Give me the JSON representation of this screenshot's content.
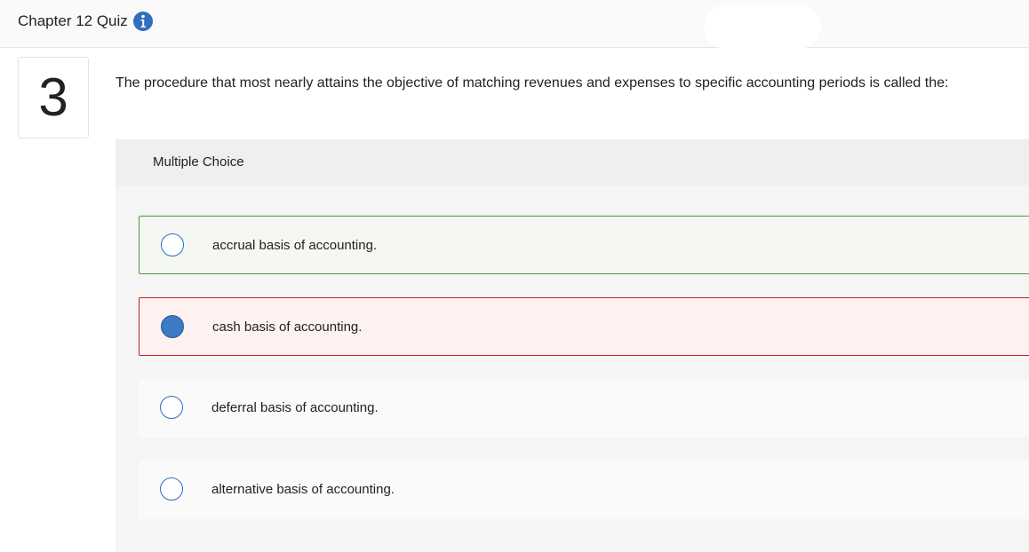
{
  "header": {
    "title": "Chapter 12 Quiz",
    "info_icon": "info-circle-icon",
    "accent_color": "#2f6fbd"
  },
  "question": {
    "number": "3",
    "text": "The procedure that most nearly attains the objective of matching revenues and expenses to specific accounting periods is called the:"
  },
  "multiple_choice": {
    "label": "Multiple Choice",
    "options": [
      {
        "text": "accrual basis of accounting.",
        "selected": false,
        "status": "correct"
      },
      {
        "text": "cash basis of accounting.",
        "selected": true,
        "status": "incorrect"
      },
      {
        "text": "deferral basis of accounting.",
        "selected": false,
        "status": "none"
      },
      {
        "text": "alternative basis of accounting.",
        "selected": false,
        "status": "none"
      }
    ]
  },
  "colors": {
    "correct_border": "#4c9a38",
    "incorrect_border": "#b82020",
    "selected_radio": "#3d7ac4"
  }
}
